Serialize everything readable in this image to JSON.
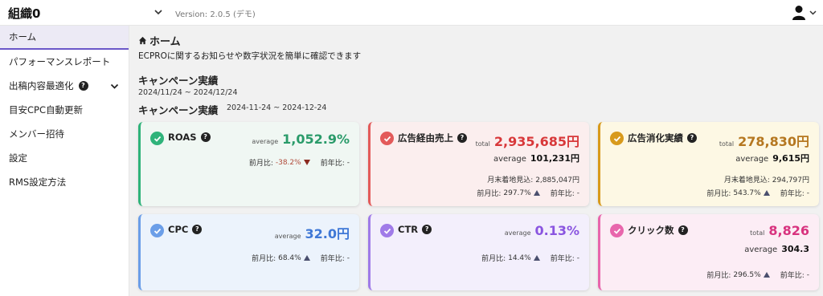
{
  "header": {
    "org_name": "組織0",
    "version": "Version: 2.0.5 (デモ)"
  },
  "sidebar": {
    "items": [
      {
        "label": "ホーム"
      },
      {
        "label": "パフォーマンスレポート"
      },
      {
        "label": "出稿内容最適化"
      },
      {
        "label": "目安CPC自動更新"
      },
      {
        "label": "メンバー招待"
      },
      {
        "label": "設定"
      },
      {
        "label": "RMS設定方法"
      }
    ]
  },
  "main": {
    "title": "ホーム",
    "subtitle": "ECPROに関するお知らせや数字状況を簡単に確認できます",
    "campaign_heading_1": "キャンペーン実績",
    "campaign_range_1": "2024/11/24 ~ 2024/12/24",
    "campaign_heading_2": "キャンペーン実績",
    "campaign_range_2": "2024-11-24 ~ 2024-12-24"
  },
  "labels": {
    "average": "average",
    "total": "total",
    "prev_month": "前月比:",
    "prev_year": "前年比:",
    "month_end_forecast": "月末着地見込:"
  },
  "cards": {
    "roas": {
      "title": "ROAS",
      "average": "1,052.9%",
      "prev_month": "-38.2%",
      "prev_year": "-",
      "color": "#2fb37a"
    },
    "sales": {
      "title": "広告経由売上",
      "total": "2,935,685円",
      "average": "101,231円",
      "forecast": "2,885,047円",
      "prev_month": "297.7%",
      "prev_year": "-",
      "color": "#e35a5a"
    },
    "spend": {
      "title": "広告消化実績",
      "total": "278,830円",
      "average": "9,615円",
      "forecast": "294,797円",
      "prev_month": "543.7%",
      "prev_year": "-",
      "color": "#d89a1c"
    },
    "cpc": {
      "title": "CPC",
      "average": "32.0円",
      "prev_month": "68.4%",
      "prev_year": "-",
      "color": "#6b9ee8"
    },
    "ctr": {
      "title": "CTR",
      "average": "0.13%",
      "prev_month": "14.4%",
      "prev_year": "-",
      "color": "#a07be8"
    },
    "clicks": {
      "title": "クリック数",
      "total": "8,826",
      "average": "304.3",
      "prev_month": "296.5%",
      "prev_year": "-",
      "color": "#e866ac"
    }
  }
}
